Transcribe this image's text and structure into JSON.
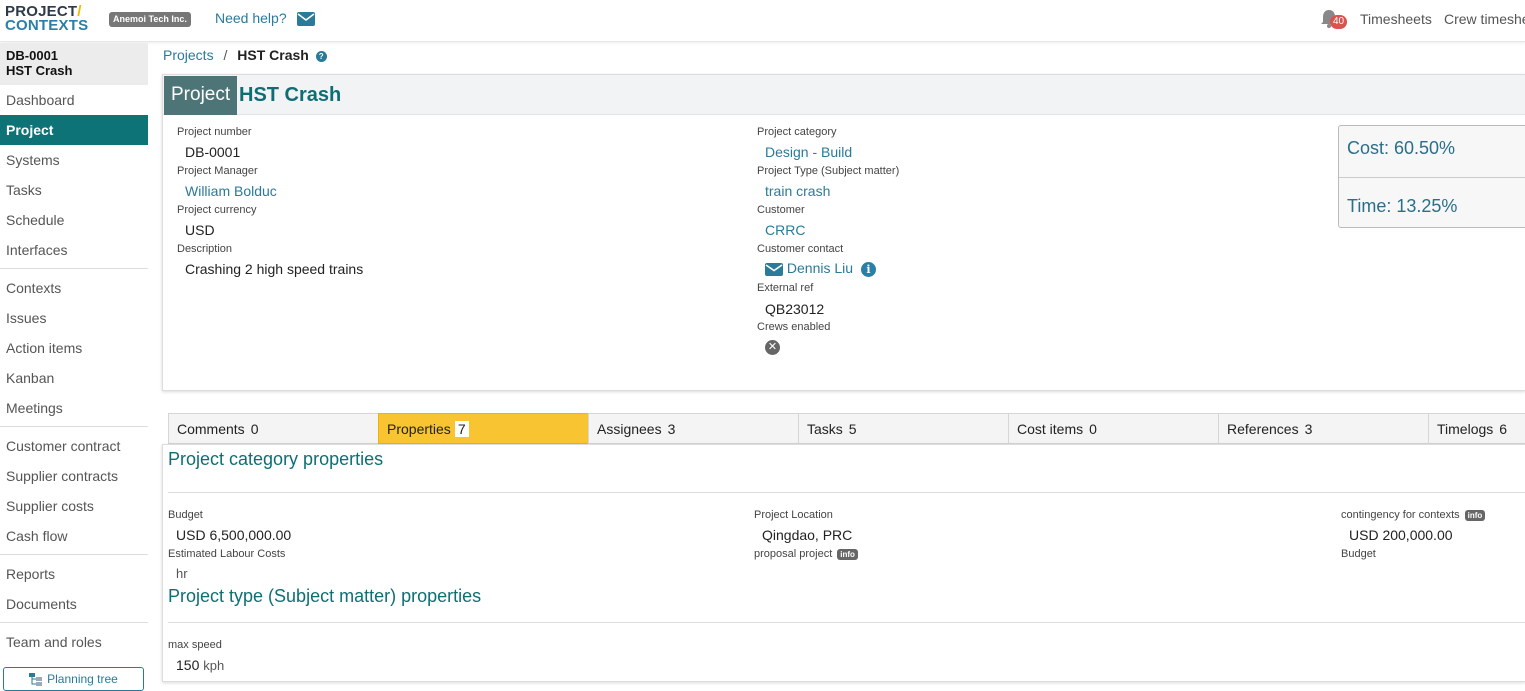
{
  "header": {
    "logo_line1": "PROJECT",
    "logo_slash": "/",
    "logo_line2": "CONTEXTS",
    "company": "Anemoi Tech Inc.",
    "need_help": "Need help?",
    "notifications_count": "40",
    "timesheets": "Timesheets",
    "crew_timesheets": "Crew timeshe"
  },
  "sidebar": {
    "project_code": "DB-0001",
    "project_name": "HST Crash",
    "groups": [
      [
        "Dashboard",
        "Project",
        "Systems",
        "Tasks",
        "Schedule",
        "Interfaces"
      ],
      [
        "Contexts",
        "Issues",
        "Action items",
        "Kanban",
        "Meetings"
      ],
      [
        "Customer contract",
        "Supplier contracts",
        "Supplier costs",
        "Cash flow"
      ],
      [
        "Reports",
        "Documents"
      ],
      [
        "Team and roles"
      ]
    ],
    "active": "Project",
    "planning_tree": "Planning tree"
  },
  "breadcrumb": {
    "root": "Projects",
    "separator": "/",
    "current": "HST Crash",
    "help": "?"
  },
  "project": {
    "tag": "Project",
    "title": "HST Crash",
    "left_fields": [
      {
        "label": "Project number",
        "value": "DB-0001",
        "link": false
      },
      {
        "label": "Project Manager",
        "value": "William Bolduc",
        "link": true
      },
      {
        "label": "Project currency",
        "value": "USD",
        "link": false
      },
      {
        "label": "Description",
        "value": "Crashing 2 high speed trains",
        "link": false
      }
    ],
    "right_fields": {
      "category_label": "Project category",
      "category_value": "Design - Build",
      "type_label": "Project Type (Subject matter)",
      "type_value": "train crash",
      "customer_label": "Customer",
      "customer_value": "CRRC",
      "contact_label": "Customer contact",
      "contact_value": "Dennis Liu",
      "external_label": "External ref",
      "external_value": "QB23012",
      "crews_label": "Crews enabled",
      "crews_value": "✕"
    },
    "stats": {
      "cost": "Cost: 60.50%",
      "time": "Time: 13.25%"
    }
  },
  "tabs": [
    {
      "label": "Comments",
      "count": "0"
    },
    {
      "label": "Properties",
      "count": "7"
    },
    {
      "label": "Assignees",
      "count": "3"
    },
    {
      "label": "Tasks",
      "count": "5"
    },
    {
      "label": "Cost items",
      "count": "0"
    },
    {
      "label": "References",
      "count": "3"
    },
    {
      "label": "Timelogs",
      "count": "6"
    }
  ],
  "active_tab": "Properties",
  "properties": {
    "category_title": "Project category properties",
    "budget_label": "Budget",
    "budget_value": "USD 6,500,000.00",
    "labour_label": "Estimated Labour Costs",
    "labour_value": "hr",
    "location_label": "Project Location",
    "location_value": "Qingdao, PRC",
    "proposal_label": "proposal project",
    "info_badge": "info",
    "contingency_label": "contingency for contexts",
    "contingency_value": "USD 200,000.00",
    "budget2_label": "Budget",
    "type_title": "Project type (Subject matter) properties",
    "max_speed_label": "max speed",
    "max_speed_value": "150",
    "max_speed_unit": "kph"
  },
  "colors": {
    "accent_teal": "#0d7377",
    "link_blue": "#2a7a99",
    "active_tab": "#f9c431",
    "notification_red": "#d9534f"
  }
}
